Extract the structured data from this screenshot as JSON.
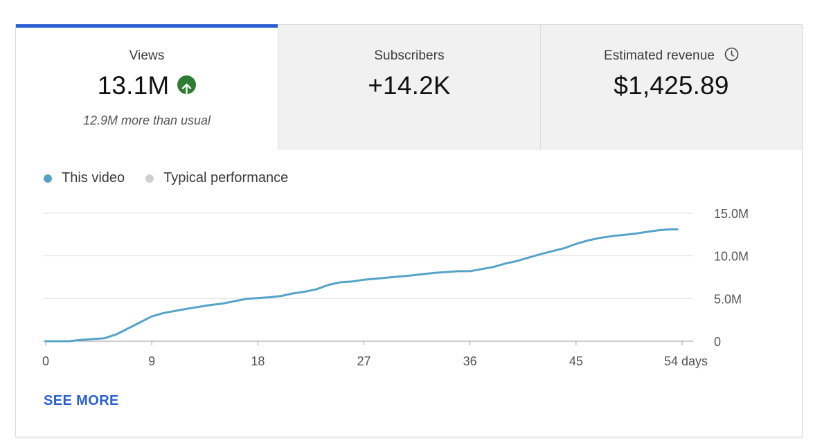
{
  "metrics": [
    {
      "label": "Views",
      "value": "13.1M",
      "sub": "12.9M more than usual",
      "icon": "arrow-up-circle-icon",
      "icon_color": "#2e7d32"
    },
    {
      "label": "Subscribers",
      "value": "+14.2K"
    },
    {
      "label": "Estimated revenue",
      "value": "$1,425.89",
      "icon": "clock-icon"
    }
  ],
  "colors": {
    "accent": "#2b5fd1",
    "this_video": "#55a3c6",
    "typical": "#cfcfcf"
  },
  "legend": {
    "this_video": "This video",
    "typical": "Typical performance"
  },
  "see_more": "SEE MORE",
  "chart_data": {
    "type": "line",
    "title": "",
    "xlabel": "",
    "ylabel": "",
    "x_ticks": [
      "0",
      "9",
      "18",
      "27",
      "36",
      "45",
      "54 days"
    ],
    "x_tick_values": [
      0,
      9,
      18,
      27,
      36,
      45,
      54
    ],
    "y_ticks": [
      "0",
      "5.0M",
      "10.0M",
      "15.0M"
    ],
    "y_tick_values": [
      0,
      5000000,
      10000000,
      15000000
    ],
    "xlim": [
      0,
      54
    ],
    "ylim": [
      0,
      15000000
    ],
    "grid": true,
    "legend_position": "top-left",
    "series": [
      {
        "name": "This video",
        "x": [
          0,
          2,
          3,
          5,
          6,
          7,
          8,
          9,
          10,
          12,
          14,
          15,
          17,
          19,
          20,
          21,
          22,
          23,
          24,
          25,
          26,
          27,
          29,
          31,
          33,
          35,
          36,
          38,
          39,
          40,
          41,
          42,
          44,
          45,
          46,
          47,
          48,
          49,
          50,
          51,
          52,
          53,
          53.6
        ],
        "y": [
          0,
          0,
          150000,
          350000,
          800000,
          1500000,
          2200000,
          2900000,
          3300000,
          3800000,
          4250000,
          4400000,
          4950000,
          5150000,
          5300000,
          5600000,
          5800000,
          6100000,
          6600000,
          6900000,
          7000000,
          7200000,
          7450000,
          7700000,
          8000000,
          8200000,
          8200000,
          8700000,
          9100000,
          9400000,
          9800000,
          10200000,
          10900000,
          11400000,
          11800000,
          12100000,
          12300000,
          12450000,
          12600000,
          12800000,
          13000000,
          13100000,
          13100000
        ]
      }
    ]
  }
}
